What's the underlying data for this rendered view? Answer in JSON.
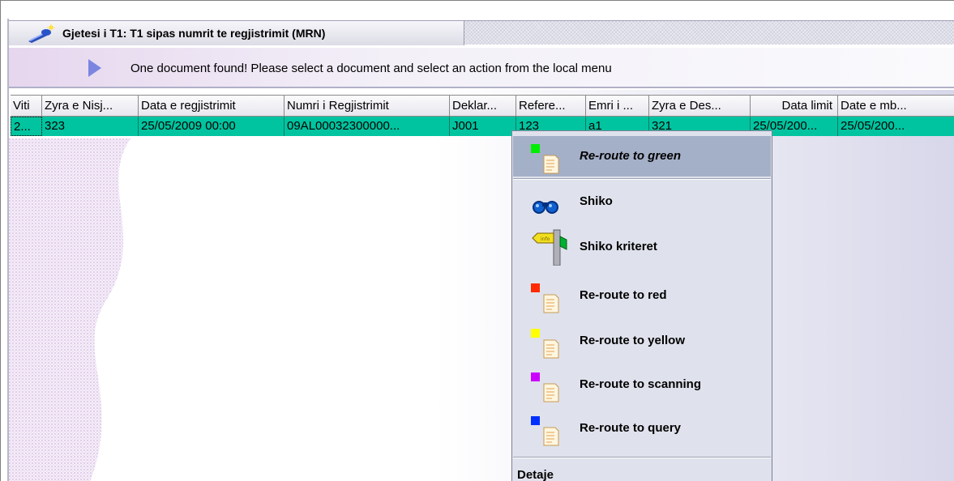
{
  "window": {
    "title": "Gjetesi i T1: T1 sipas numrit te regjistrimit (MRN)",
    "icon": "search-wand-icon"
  },
  "info": {
    "message": "One document found! Please select a document and select an action from the local menu",
    "icon": "play-arrow-icon"
  },
  "table": {
    "columns": [
      "Viti",
      "Zyra e Nisj...",
      "Data e regjistrimit",
      "Numri i Regjistrimit",
      "Deklar...",
      "Refere...",
      "Emri i ...",
      "Zyra e Des...",
      "Data limit",
      "Date e mb..."
    ],
    "rows": [
      [
        "2...",
        "323",
        "25/05/2009 00:00",
        "09AL00032300000...",
        "J001",
        "123",
        "a1",
        "321",
        "25/05/200...",
        "25/05/200..."
      ]
    ]
  },
  "context_menu": {
    "items": [
      {
        "label": "Re-route to green",
        "icon": "green-document-icon",
        "color": "#00ee00",
        "selected": true
      },
      {
        "label": "Shiko",
        "icon": "binoculars-icon"
      },
      {
        "label": "Shiko kriteret",
        "icon": "signpost-icon"
      },
      {
        "label": "Re-route to red",
        "icon": "red-document-icon",
        "color": "#ff2a00"
      },
      {
        "label": "Re-route to yellow",
        "icon": "yellow-document-icon",
        "color": "#ffff00"
      },
      {
        "label": "Re-route to scanning",
        "icon": "magenta-document-icon",
        "color": "#cc00ff"
      },
      {
        "label": "Re-route to query",
        "icon": "blue-document-icon",
        "color": "#0030ff"
      }
    ],
    "details_label": "Detaje"
  },
  "colors": {
    "selected_row": "#00c4a0",
    "menu_background": "#dfe2ec",
    "menu_selected": "#a4b0c8"
  }
}
